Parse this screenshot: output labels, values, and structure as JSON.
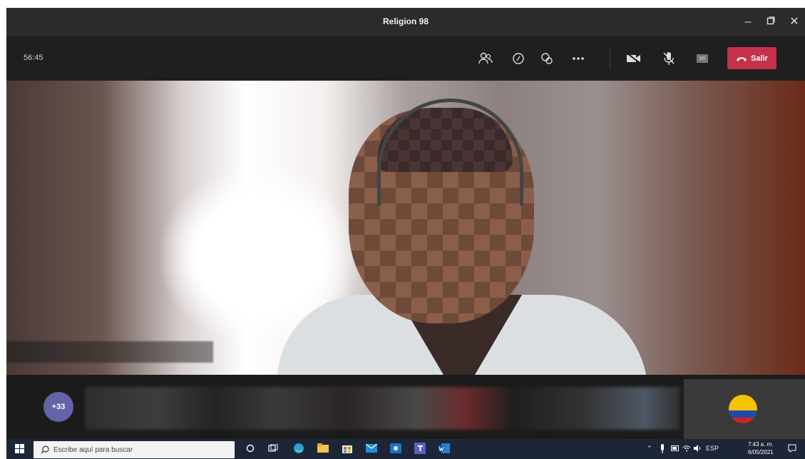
{
  "window": {
    "title": "Religion 98",
    "minimize_icon": "minimize-icon",
    "restore_icon": "restore-icon",
    "close_icon": "close-icon"
  },
  "toolbar": {
    "timer": "56:45",
    "leave_label": "Salir",
    "icons": [
      "participants-icon",
      "chat-icon",
      "reactions-icon",
      "more-options-icon",
      "camera-off-icon",
      "mic-off-icon",
      "share-screen-icon"
    ],
    "leave_color": "#c4314b"
  },
  "participants": {
    "overflow_count": "+33",
    "avatar_color": "#6264a7"
  },
  "taskbar": {
    "search_placeholder": "Escribe aquí para buscar",
    "language": "ESP",
    "time": "7:43 a. m.",
    "date": "6/05/2021"
  }
}
